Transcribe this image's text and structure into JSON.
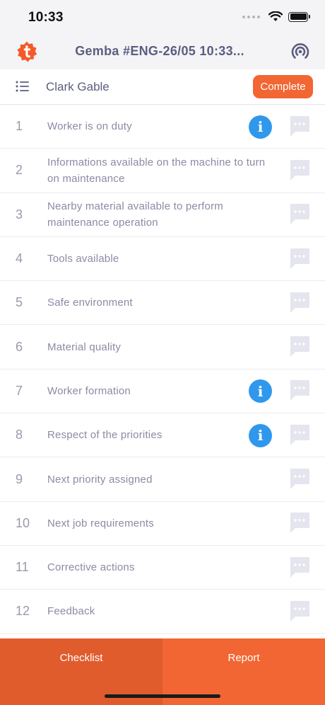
{
  "status_bar": {
    "time": "10:33"
  },
  "header": {
    "title": "Gemba #ENG-26/05 10:33..."
  },
  "sub_header": {
    "user_name": "Clark Gable",
    "complete_label": "Complete"
  },
  "checklist": {
    "items": [
      {
        "number": "1",
        "label": "Worker is on duty",
        "has_info": true
      },
      {
        "number": "2",
        "label": "Informations available on the machine to turn on maintenance",
        "has_info": false
      },
      {
        "number": "3",
        "label": "Nearby material available to perform maintenance operation",
        "has_info": false
      },
      {
        "number": "4",
        "label": "Tools available",
        "has_info": false
      },
      {
        "number": "5",
        "label": "Safe environment",
        "has_info": false
      },
      {
        "number": "6",
        "label": "Material quality",
        "has_info": false
      },
      {
        "number": "7",
        "label": "Worker formation",
        "has_info": true
      },
      {
        "number": "8",
        "label": "Respect of the priorities",
        "has_info": true
      },
      {
        "number": "9",
        "label": "Next priority assigned",
        "has_info": false
      },
      {
        "number": "10",
        "label": "Next job requirements",
        "has_info": false
      },
      {
        "number": "11",
        "label": "Corrective actions",
        "has_info": false
      },
      {
        "number": "12",
        "label": "Feedback",
        "has_info": false
      }
    ],
    "info_glyph": "i"
  },
  "tabs": [
    {
      "label": "Checklist",
      "active": true
    },
    {
      "label": "Report",
      "active": false
    }
  ],
  "colors": {
    "accent": "#f26633",
    "info": "#2f98ed",
    "text_muted": "#8a8ba3",
    "title": "#5c5d7f"
  },
  "icons": {
    "logo": "app-logo-icon",
    "broadcast": "broadcast-icon",
    "list": "list-icon",
    "info": "info-icon",
    "comment": "comment-icon"
  }
}
